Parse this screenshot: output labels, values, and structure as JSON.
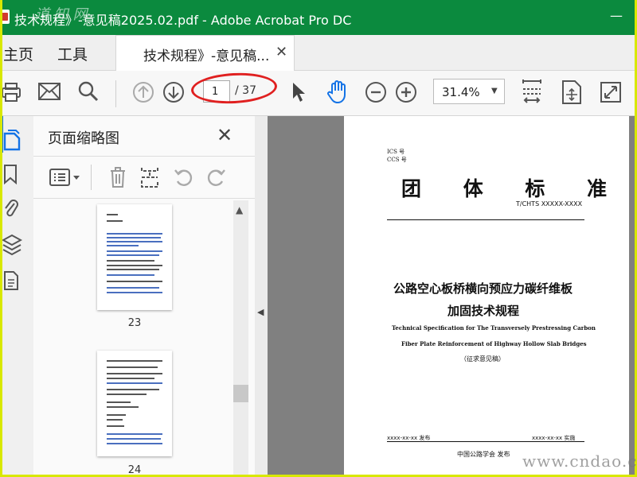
{
  "window": {
    "title": "技术规程》-意见稿2025.02.pdf - Adobe Acrobat Pro DC",
    "minimize_glyph": "—",
    "watermark_top": "道 知 网"
  },
  "menu": {
    "home": "主页",
    "tools": "工具",
    "doc_tab": "技术规程》-意见稿...",
    "close_tab": "✕"
  },
  "toolbar": {
    "page_current": "1",
    "page_total": "/ 37",
    "zoom": "31.4%",
    "zoom_arrow": "▼",
    "icons": [
      "print-icon",
      "mail-icon",
      "search-icon",
      "page-up-icon",
      "page-down-icon",
      "select-cursor-icon",
      "hand-tool-icon",
      "zoom-out-icon",
      "zoom-in-icon",
      "fit-page-icon",
      "rotate-icon",
      "fullscreen-icon"
    ]
  },
  "sidebar_rail": {
    "icons": [
      "page-thumbnails-icon",
      "bookmark-icon",
      "attachment-icon",
      "layers-icon",
      "document-properties-icon"
    ]
  },
  "thumb_panel": {
    "title": "页面缩略图",
    "close": "✕",
    "tools": [
      "options-icon",
      "delete-icon",
      "extract-icon",
      "rotate-left-icon",
      "rotate-right-icon"
    ],
    "pages": [
      {
        "number": "23"
      },
      {
        "number": "24"
      }
    ],
    "scroll_up": "▲"
  },
  "collapse": {
    "arrow": "◀"
  },
  "document_page": {
    "ics": "ICS 号",
    "ccs": "CCS 号",
    "heading": "团  体  标  准",
    "code": "T/CHTS  XXXXX-XXXX",
    "title_line1": "公路空心板桥横向预应力碳纤维板",
    "title_line2": "加固技术规程",
    "en_line1": "Technical Specification for The Transversely Prestressing Carbon",
    "en_line2": "Fiber Plate Reinforcement of Highway Hollow Slab Bridges",
    "draft": "（征求意见稿）",
    "issue_date": "xxxx-xx-xx 发布",
    "implement_date": "xxxx-xx-xx 实施",
    "publisher": "中国公路学会  发布"
  },
  "watermark_bottom": "www.cndao.com",
  "colors": {
    "titlebar": "#0b8a3e",
    "accent": "#1473e6",
    "annotation": "#e02020",
    "frame": "#d8e800"
  }
}
